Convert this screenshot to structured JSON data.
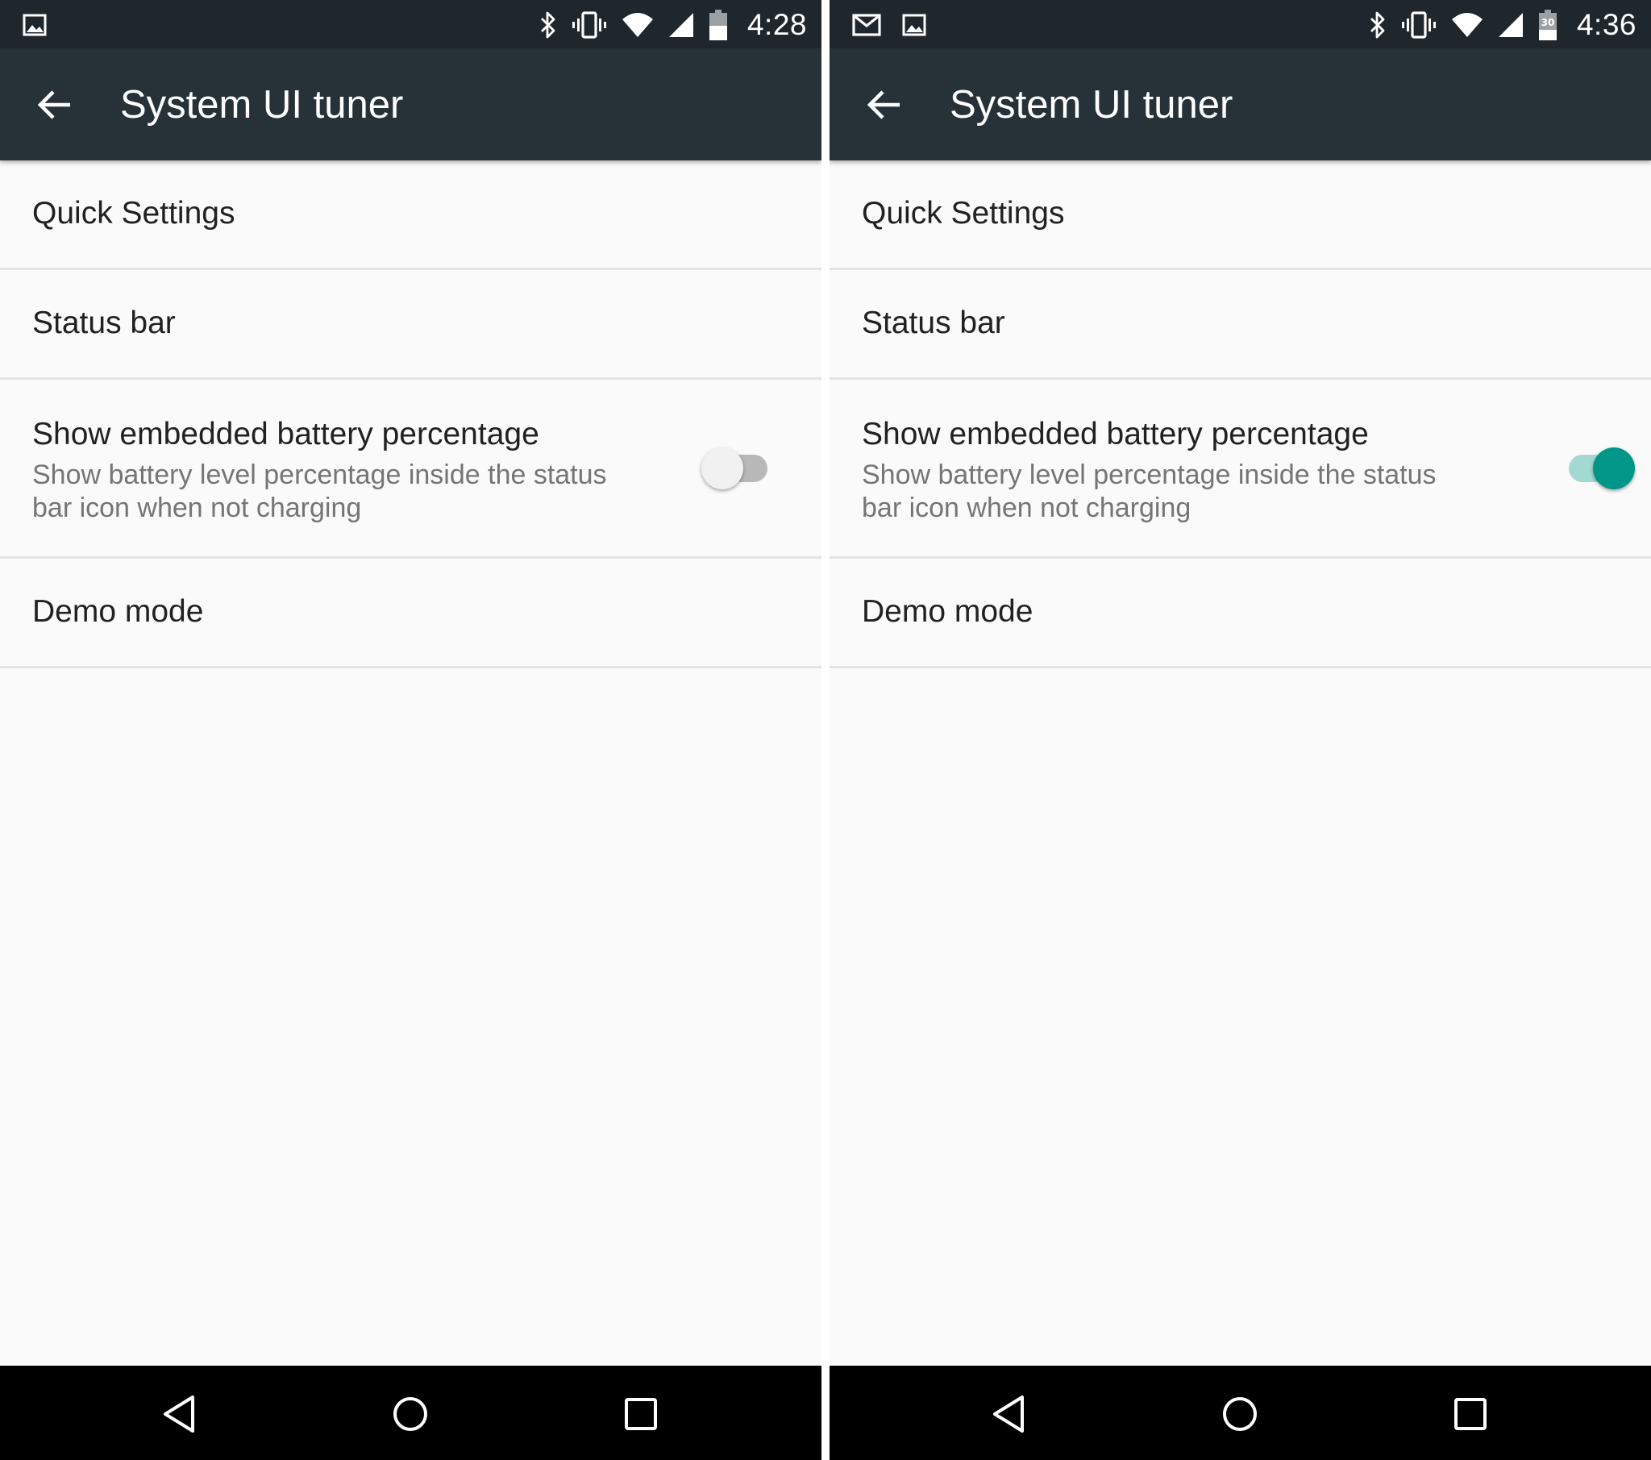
{
  "screens": [
    {
      "status_bar": {
        "left_icons": [
          "image-icon"
        ],
        "right_icons": [
          "bluetooth-icon",
          "vibrate-icon",
          "wifi-icon",
          "cell-signal-icon",
          "battery-icon"
        ],
        "time": "4:28"
      },
      "app_bar": {
        "title": "System UI tuner",
        "back_icon": "arrow-left-icon"
      },
      "items": [
        {
          "title": "Quick Settings"
        },
        {
          "title": "Status bar"
        },
        {
          "title": "Show embedded battery percentage",
          "summary": "Show battery level percentage inside the status bar icon when not charging",
          "switch_state": "off"
        },
        {
          "title": "Demo mode"
        }
      ],
      "nav_bar": {
        "buttons": [
          "nav-back-icon",
          "nav-home-icon",
          "nav-recents-icon"
        ]
      }
    },
    {
      "status_bar": {
        "left_icons": [
          "gmail-icon",
          "image-icon"
        ],
        "right_icons": [
          "bluetooth-icon",
          "vibrate-icon",
          "wifi-icon",
          "cell-signal-icon",
          "battery-icon"
        ],
        "battery_text": "30",
        "time": "4:36"
      },
      "app_bar": {
        "title": "System UI tuner",
        "back_icon": "arrow-left-icon"
      },
      "items": [
        {
          "title": "Quick Settings"
        },
        {
          "title": "Status bar"
        },
        {
          "title": "Show embedded battery percentage",
          "summary": "Show battery level percentage inside the status bar icon when not charging",
          "switch_state": "on"
        },
        {
          "title": "Demo mode"
        }
      ],
      "nav_bar": {
        "buttons": [
          "nav-back-icon",
          "nav-home-icon",
          "nav-recents-icon"
        ]
      }
    }
  ],
  "colors": {
    "status_bar_bg": "#20272c",
    "app_bar_bg": "#263238",
    "accent": "#009688",
    "switch_track_on": "#a3d9d3",
    "switch_track_off": "#b8b8b8",
    "divider": "#e3e3e3",
    "title_text": "#212121",
    "summary_text": "#757575"
  }
}
